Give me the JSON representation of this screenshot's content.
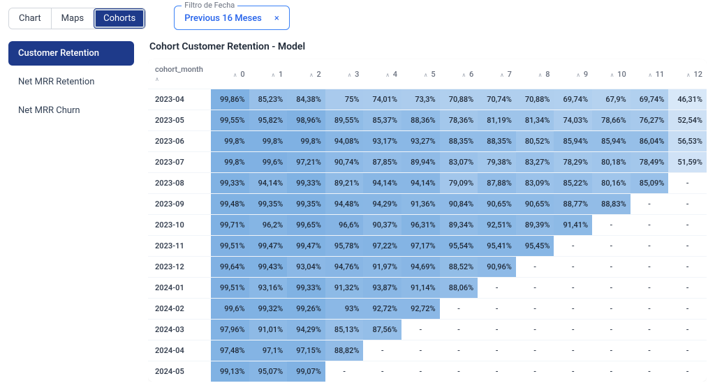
{
  "tabs": {
    "chart": "Chart",
    "maps": "Maps",
    "cohorts": "Cohorts"
  },
  "filter": {
    "label": "Filtro de Fecha",
    "value": "Previous 16 Meses"
  },
  "sidebar": {
    "items": [
      {
        "label": "Customer Retention"
      },
      {
        "label": "Net MRR Retention"
      },
      {
        "label": "Net MRR Churn"
      }
    ]
  },
  "card": {
    "title": "Cohort Customer Retention - Model"
  },
  "chart_data": {
    "type": "heatmap",
    "title": "Cohort Customer Retention - Model",
    "row_header": "cohort_month",
    "columns": [
      "0",
      "1",
      "2",
      "3",
      "4",
      "5",
      "6",
      "7",
      "8",
      "9",
      "10",
      "11",
      "12"
    ],
    "rows": [
      {
        "label": "2023-04",
        "values": [
          "99,86%",
          "85,23%",
          "84,38%",
          "75%",
          "74,01%",
          "73,3%",
          "70,88%",
          "70,74%",
          "70,88%",
          "69,74%",
          "67,9%",
          "69,74%",
          "46,31%"
        ]
      },
      {
        "label": "2023-05",
        "values": [
          "99,55%",
          "95,82%",
          "98,96%",
          "89,55%",
          "85,37%",
          "88,36%",
          "78,36%",
          "81,19%",
          "81,34%",
          "74,03%",
          "78,66%",
          "76,27%",
          "52,54%"
        ]
      },
      {
        "label": "2023-06",
        "values": [
          "99,8%",
          "99,8%",
          "99,8%",
          "94,08%",
          "93,17%",
          "93,27%",
          "88,35%",
          "88,35%",
          "80,52%",
          "85,94%",
          "85,94%",
          "86,04%",
          "56,53%"
        ]
      },
      {
        "label": "2023-07",
        "values": [
          "99,8%",
          "99,6%",
          "97,21%",
          "90,74%",
          "87,85%",
          "89,94%",
          "83,07%",
          "79,38%",
          "83,27%",
          "78,29%",
          "80,18%",
          "78,49%",
          "51,59%"
        ]
      },
      {
        "label": "2023-08",
        "values": [
          "99,33%",
          "94,14%",
          "99,33%",
          "89,21%",
          "94,14%",
          "94,14%",
          "79,09%",
          "87,88%",
          "83,09%",
          "85,22%",
          "80,16%",
          "85,09%",
          "-"
        ]
      },
      {
        "label": "2023-09",
        "values": [
          "99,48%",
          "99,35%",
          "99,35%",
          "94,48%",
          "94,29%",
          "91,36%",
          "90,84%",
          "90,65%",
          "90,65%",
          "88,77%",
          "88,83%",
          "-",
          "-"
        ]
      },
      {
        "label": "2023-10",
        "values": [
          "99,71%",
          "96,2%",
          "99,65%",
          "96,6%",
          "90,37%",
          "96,31%",
          "89,34%",
          "92,51%",
          "89,39%",
          "91,41%",
          "-",
          "-",
          "-"
        ]
      },
      {
        "label": "2023-11",
        "values": [
          "99,51%",
          "99,47%",
          "99,47%",
          "95,78%",
          "97,22%",
          "97,17%",
          "95,54%",
          "95,41%",
          "95,45%",
          "-",
          "-",
          "-",
          "-"
        ]
      },
      {
        "label": "2023-12",
        "values": [
          "99,64%",
          "99,43%",
          "93,04%",
          "94,76%",
          "91,97%",
          "94,69%",
          "88,52%",
          "90,96%",
          "-",
          "-",
          "-",
          "-",
          "-"
        ]
      },
      {
        "label": "2024-01",
        "values": [
          "99,51%",
          "93,16%",
          "99,33%",
          "91,32%",
          "93,87%",
          "91,14%",
          "88,06%",
          "-",
          "-",
          "-",
          "-",
          "-",
          "-"
        ]
      },
      {
        "label": "2024-02",
        "values": [
          "99,6%",
          "99,32%",
          "99,26%",
          "93%",
          "92,72%",
          "92,72%",
          "-",
          "-",
          "-",
          "-",
          "-",
          "-",
          "-"
        ]
      },
      {
        "label": "2024-03",
        "values": [
          "97,96%",
          "91,01%",
          "94,29%",
          "85,13%",
          "87,56%",
          "-",
          "-",
          "-",
          "-",
          "-",
          "-",
          "-",
          "-"
        ]
      },
      {
        "label": "2024-04",
        "values": [
          "97,48%",
          "97,1%",
          "97,15%",
          "88,82%",
          "-",
          "-",
          "-",
          "-",
          "-",
          "-",
          "-",
          "-",
          "-"
        ]
      },
      {
        "label": "2024-05",
        "values": [
          "99,13%",
          "95,07%",
          "99,07%",
          "-",
          "-",
          "-",
          "-",
          "-",
          "-",
          "-",
          "-",
          "-",
          "-"
        ]
      }
    ],
    "color_scale": {
      "high": "#7fb1e3",
      "low": "#d9e8f8"
    }
  }
}
